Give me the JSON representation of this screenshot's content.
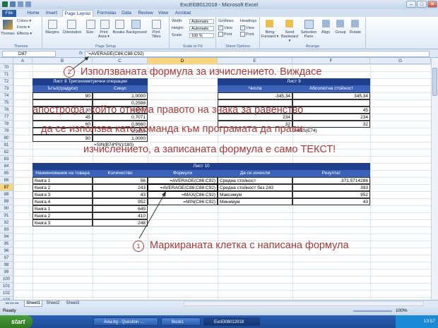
{
  "window": {
    "title": "ExcEl08012018 - Microsoft Excel",
    "min": "–",
    "max": "□",
    "close": "✕"
  },
  "tabs": [
    "File",
    "Home",
    "Insert",
    "Page Layout",
    "Formulas",
    "Data",
    "Review",
    "View",
    "Acrobat"
  ],
  "active_tab": "Page Layout",
  "ribbon": {
    "themes": {
      "label": "Themes",
      "colors": "Colors ▾",
      "fonts": "Fonts ▾",
      "effects": "Effects ▾",
      "group": "Themes"
    },
    "page_setup": {
      "margins": "Margins",
      "orientation": "Orientation",
      "size": "Size",
      "print_area": "Print Area ▾",
      "breaks": "Breaks",
      "background": "Background",
      "print_titles": "Print Titles",
      "group": "Page Setup"
    },
    "scale": {
      "width_label": "Width:",
      "width_val": "Automatic",
      "height_label": "Height:",
      "height_val": "Automatic",
      "scale_label": "Scale:",
      "scale_val": "100 %",
      "group": "Scale to Fit"
    },
    "sheet_options": {
      "gridlines": "Gridlines",
      "headings": "Headings",
      "view": "View",
      "print": "Print",
      "group": "Sheet Options"
    },
    "arrange": {
      "bring_forward": "Bring Forward ▾",
      "send_backward": "Send Backward ▾",
      "selection_pane": "Selection Pane",
      "align": "Align",
      "group_btn": "Group",
      "rotate": "Rotate",
      "group": "Arrange"
    }
  },
  "formula_bar": {
    "name_box": "D87",
    "fx": "fx",
    "formula": "'=AVERAGE(C86;C88:C92)"
  },
  "columns": [
    "A",
    "B",
    "C",
    "D",
    "E",
    "F",
    "G"
  ],
  "rows": [
    "70",
    "71",
    "72",
    "73",
    "74",
    "75",
    "76",
    "77",
    "78",
    "79",
    "80",
    "81",
    "82",
    "83",
    "84",
    "85",
    "86",
    "87",
    "88",
    "89",
    "90",
    "91",
    "92",
    "93",
    "94",
    "95",
    "96",
    "97",
    "98",
    "99",
    "100",
    "101",
    "102",
    "103"
  ],
  "selected_row": "87",
  "selected_col": "D",
  "sheet8": {
    "title": "Лист 8 Тригонометрични операции",
    "headers": [
      "Ъгъл(градуси)",
      "Синус"
    ],
    "angles": [
      "90",
      "",
      "30",
      "45",
      "60",
      "",
      "90"
    ],
    "sines": [
      "1,0000",
      "0,2588",
      "0,5000",
      "0,7071",
      "0,8660",
      "0,9659",
      "1,0000"
    ],
    "formula_text": "=SIN(B74*PI()/180)"
  },
  "sheet9": {
    "title": "Лист 9",
    "headers": [
      "Числа",
      "Абсолютна стойност"
    ],
    "numbers": [
      "-345,34",
      "",
      "",
      "234",
      "32"
    ],
    "abs": [
      "345,34",
      "",
      "45",
      "234",
      "32"
    ],
    "formula_text": "=ABS(E74)"
  },
  "sheet10": {
    "title": "Лист 10",
    "headers": [
      "Наименование на товара",
      "Количество",
      "Формули",
      "Да се изчисли",
      "Резултат"
    ],
    "rows": [
      [
        "Книга 1",
        "56",
        "=AVERAGE(C86:C92)",
        "Средна стойност",
        "371,5714286"
      ],
      [
        "Книга 2",
        "243",
        "=AVERAGE(C86;C88:C92)",
        "Средна стойност без 243",
        "393"
      ],
      [
        "Книга 3",
        "43",
        "=MAX(C86:C92)",
        "Максимум",
        "952"
      ],
      [
        "Книга 4",
        "952",
        "=MIN(C86:C92)",
        "Минимум",
        "43"
      ],
      [
        "Книга 1",
        "649",
        "",
        "",
        ""
      ],
      [
        "Книга 2",
        "410",
        "",
        "",
        ""
      ],
      [
        "Книга 3",
        "248",
        "",
        "",
        ""
      ]
    ]
  },
  "annotations": {
    "note2_num": "2",
    "note2_lines": [
      "Използваната формула за изчислението. Виждасе",
      "апострофа, който отнема правото на знака за равенство",
      "да се използва като команда към програмата да прави",
      "изчислението, а записаната формула е само ТЕКСТ!"
    ],
    "note1_num": "1",
    "note1_text": "Маркираната клетка с написана формула"
  },
  "sheet_tabs": [
    "Sheet1",
    "Sheet2",
    "Sheet3"
  ],
  "status": {
    "ready": "Ready",
    "zoom": "100%"
  },
  "taskbar": {
    "start": "start",
    "items": [
      "Avia.bg - Question -...",
      "Book1",
      "ExcEl08012018"
    ],
    "clock": "13:57"
  }
}
